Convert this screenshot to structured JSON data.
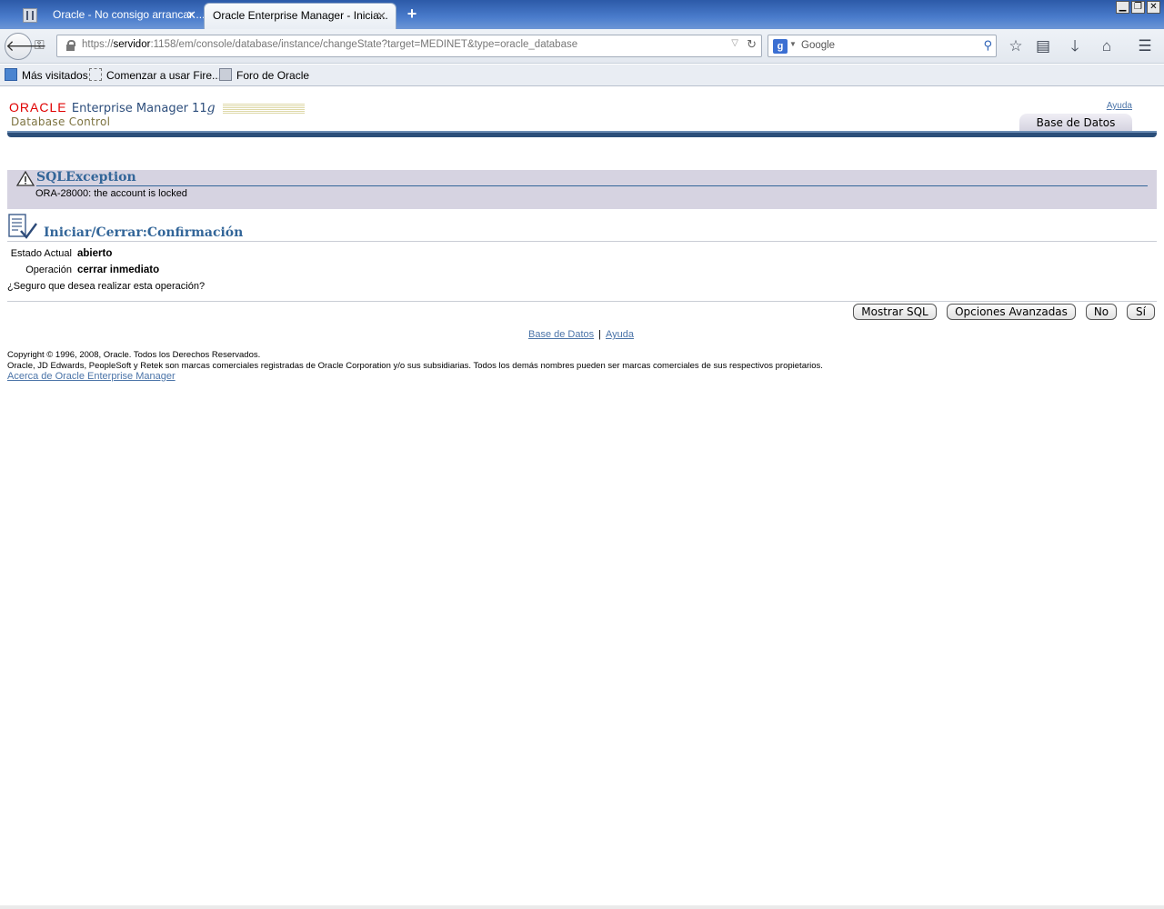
{
  "browser": {
    "tabs": [
      {
        "title": "Oracle - No consigo arrancar ...",
        "active": false
      },
      {
        "title": "Oracle Enterprise Manager - Inicia...",
        "active": true
      }
    ],
    "new_tab_glyph": "+",
    "url": {
      "prefix": "https://",
      "host": "servidor",
      "rest": ":1158/em/console/database/instance/changeState?target=MEDINET&type=oracle_database"
    },
    "search": {
      "engine_icon": "g",
      "placeholder": "Google"
    },
    "bookmarks": [
      {
        "label": "Más visitados",
        "icon": "most-visited-icon"
      },
      {
        "label": "Comenzar a usar Fire...",
        "icon": "getting-started-icon"
      },
      {
        "label": "Foro de Oracle",
        "icon": "oracle-forum-icon"
      }
    ]
  },
  "header": {
    "brand_oracle": "ORACLE",
    "brand_product": "Enterprise Manager 11",
    "brand_version_letter": "g",
    "brand_subtitle": "Database Control",
    "help_link": "Ayuda",
    "main_tab": "Base de Datos"
  },
  "error": {
    "title": "SQLException",
    "message": "ORA-28000: the account is locked"
  },
  "confirmation": {
    "title": "Iniciar/Cerrar:Confirmación",
    "fields": [
      {
        "label": "Estado Actual",
        "value": "abierto"
      },
      {
        "label": "Operación",
        "value": "cerrar inmediato"
      }
    ],
    "question": "¿Seguro que desea realizar esta operación?"
  },
  "buttons": {
    "show_sql": "Mostrar SQL",
    "advanced_options": "Opciones Avanzadas",
    "no": "No",
    "yes": "Sí"
  },
  "footer": {
    "links": [
      "Base de Datos",
      "Ayuda"
    ],
    "separator": "|",
    "copyright_line1": "Copyright © 1996, 2008, Oracle. Todos los Derechos Reservados.",
    "copyright_line2": "Oracle, JD Edwards, PeopleSoft y Retek son marcas comerciales registradas de Oracle Corporation y/o sus subsidiarias. Todos los demás nombres pueden ser marcas comerciales de sus respectivos propietarios.",
    "about_link": "Acerca de Oracle Enterprise Manager"
  },
  "colors": {
    "accent_blue": "#336699",
    "oracle_red": "#e00000",
    "error_bg": "#d6d3e1",
    "link": "#4b74a8"
  }
}
